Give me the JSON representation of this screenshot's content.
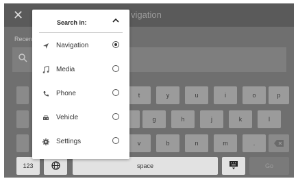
{
  "topbar": {
    "close_glyph": "✕",
    "title": "vigation"
  },
  "recent_label": "Recen",
  "panel": {
    "title": "Search in:",
    "options": [
      {
        "label": "Navigation",
        "icon": "navigation-arrow-icon",
        "selected": true
      },
      {
        "label": "Media",
        "icon": "music-note-icon",
        "selected": false
      },
      {
        "label": "Phone",
        "icon": "phone-icon",
        "selected": false
      },
      {
        "label": "Vehicle",
        "icon": "car-icon",
        "selected": false
      },
      {
        "label": "Settings",
        "icon": "gear-icon",
        "selected": false
      }
    ]
  },
  "keyboard": {
    "row1": [
      "t",
      "y",
      "u",
      "i",
      "o",
      "p"
    ],
    "row2": [
      "g",
      "h",
      "j",
      "k",
      "l"
    ],
    "row3": [
      "v",
      "b",
      "n",
      "m",
      "."
    ],
    "bottom": {
      "num_key": "123",
      "space": "space",
      "go": "Go"
    }
  }
}
